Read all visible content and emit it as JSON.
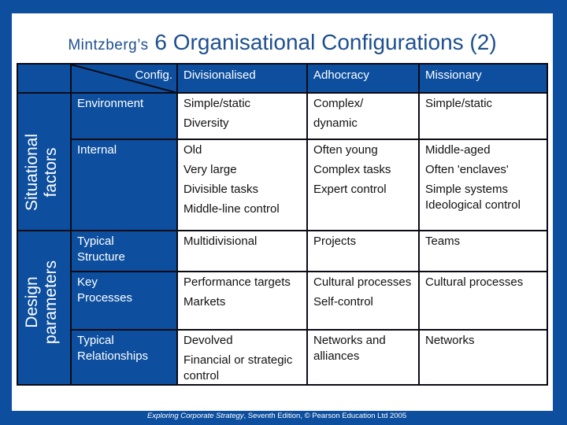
{
  "title": {
    "prefix": "Mintzberg’s",
    "main": "6 Organisational Configurations (2)"
  },
  "header": {
    "corner_label": "Config.",
    "columns": [
      "Divisionalised",
      "Adhocracy",
      "Missionary"
    ]
  },
  "groups": [
    {
      "label_line1": "Situational",
      "label_line2": "factors",
      "rows": [
        {
          "label": "Environment",
          "cells": [
            [
              "Simple/static",
              "Diversity"
            ],
            [
              "Complex/",
              "dynamic"
            ],
            [
              "Simple/static"
            ]
          ]
        },
        {
          "label": "Internal",
          "cells": [
            [
              "Old",
              "Very large",
              "Divisible tasks",
              "Middle-line control"
            ],
            [
              "Often young",
              "Complex tasks",
              "Expert control"
            ],
            [
              "Middle-aged",
              "Often 'enclaves'",
              "Simple systems Ideological control"
            ]
          ]
        }
      ]
    },
    {
      "label_line1": "Design",
      "label_line2": "parameters",
      "rows": [
        {
          "label": "Typical Structure",
          "cells": [
            [
              "Multidivisional"
            ],
            [
              "Projects"
            ],
            [
              "Teams"
            ]
          ]
        },
        {
          "label": "Key Processes",
          "cells": [
            [
              "Performance targets",
              "Markets"
            ],
            [
              "Cultural processes",
              "Self-control"
            ],
            [
              "Cultural processes"
            ]
          ]
        },
        {
          "label": "Typical Relationships",
          "cells": [
            [
              "Devolved",
              "Financial or strategic control"
            ],
            [
              "Networks and alliances"
            ],
            [
              "Networks"
            ]
          ]
        }
      ]
    }
  ],
  "footer": {
    "book_title": "Exploring Corporate Strategy",
    "rest": ", Seventh Edition, © Pearson Education Ltd 2005"
  },
  "colors": {
    "frame_blue": "#0d4f9e",
    "title_blue": "#1d4f8f",
    "grid_line": "#0a0a14"
  }
}
